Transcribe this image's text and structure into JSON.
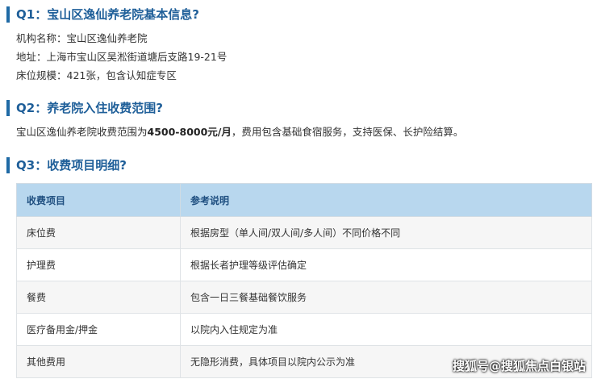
{
  "q1": {
    "title": "Q1：宝山区逸仙养老院基本信息?",
    "lines": [
      "机构名称：宝山区逸仙养老院",
      "地址：上海市宝山区吴淞街道塘后支路19-21号",
      "床位规模：421张，包含认知症专区"
    ]
  },
  "q2": {
    "title": "Q2：养老院入住收费范围?",
    "text_before": "宝山区逸仙养老院收费范围为",
    "text_bold": "4500-8000元/月",
    "text_after": "，费用包含基础食宿服务，支持医保、长护险结算。"
  },
  "q3": {
    "title": "Q3：收费项目明细?",
    "table": {
      "headers": [
        "收费项目",
        "参考说明"
      ],
      "rows": [
        [
          "床位费",
          "根据房型（单人间/双人间/多人间）不同价格不同"
        ],
        [
          "护理费",
          "根据长者护理等级评估确定"
        ],
        [
          "餐费",
          "包含一日三餐基础餐饮服务"
        ],
        [
          "医疗备用金/押金",
          "以院内入住规定为准"
        ],
        [
          "其他费用",
          "无隐形消费，具体项目以院内公示为准"
        ]
      ]
    }
  },
  "watermark": "搜狐号@搜狐焦点白银站"
}
